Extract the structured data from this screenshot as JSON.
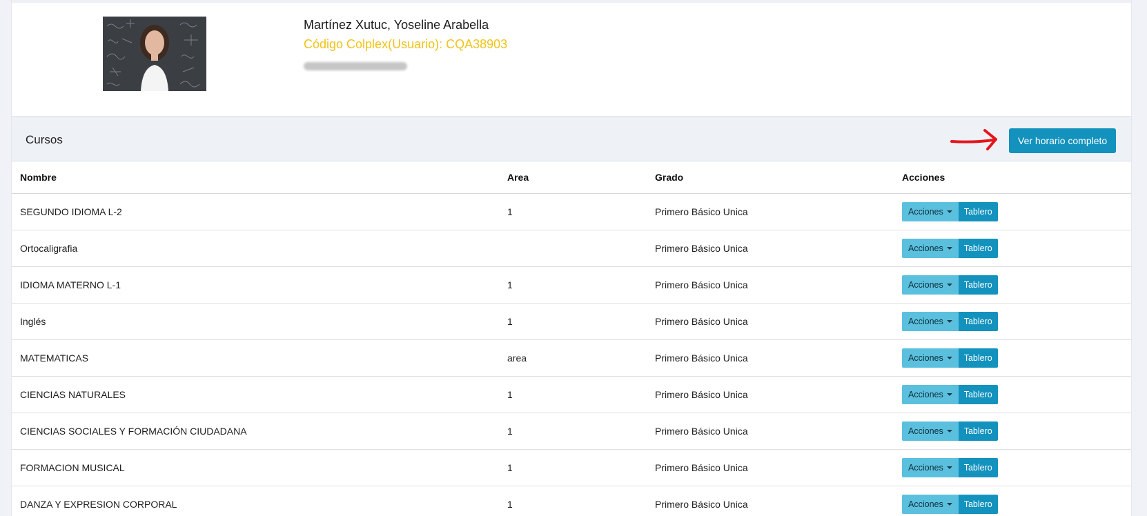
{
  "profile": {
    "name": "Martínez Xutuc, Yoseline Arabella",
    "code": "Código Colplex(Usuario): CQA38903"
  },
  "courses_card": {
    "title": "Cursos",
    "schedule_button": "Ver horario completo",
    "columns": {
      "nombre": "Nombre",
      "area": "Area",
      "grado": "Grado",
      "acciones": "Acciones"
    },
    "rows": [
      {
        "nombre": "SEGUNDO IDIOMA L-2",
        "area": "1",
        "grado": "Primero Básico Unica"
      },
      {
        "nombre": "Ortocaligrafia",
        "area": "",
        "grado": "Primero Básico Unica"
      },
      {
        "nombre": "IDIOMA MATERNO L-1",
        "area": "1",
        "grado": "Primero Básico Unica"
      },
      {
        "nombre": "Inglés",
        "area": "1",
        "grado": "Primero Básico Unica"
      },
      {
        "nombre": "MATEMATICAS",
        "area": "area",
        "grado": "Primero Básico Unica"
      },
      {
        "nombre": "CIENCIAS NATURALES",
        "area": "1",
        "grado": "Primero Básico Unica"
      },
      {
        "nombre": "CIENCIAS SOCIALES Y FORMACIÓN CIUDADANA",
        "area": "1",
        "grado": "Primero Básico Unica"
      },
      {
        "nombre": "FORMACION MUSICAL",
        "area": "1",
        "grado": "Primero Básico Unica"
      },
      {
        "nombre": "DANZA Y EXPRESION CORPORAL",
        "area": "1",
        "grado": "Primero Básico Unica"
      }
    ],
    "row_actions": {
      "acciones_label": "Acciones",
      "tablero_label": "Tablero"
    }
  },
  "colors": {
    "primary_button": "#1392be",
    "secondary_button": "#5bc0de",
    "code_text": "#f2c318",
    "annotation_arrow": "#e3161c"
  },
  "icons": {
    "dropdown": "caret-down-icon",
    "annotation": "red-arrow-icon"
  }
}
